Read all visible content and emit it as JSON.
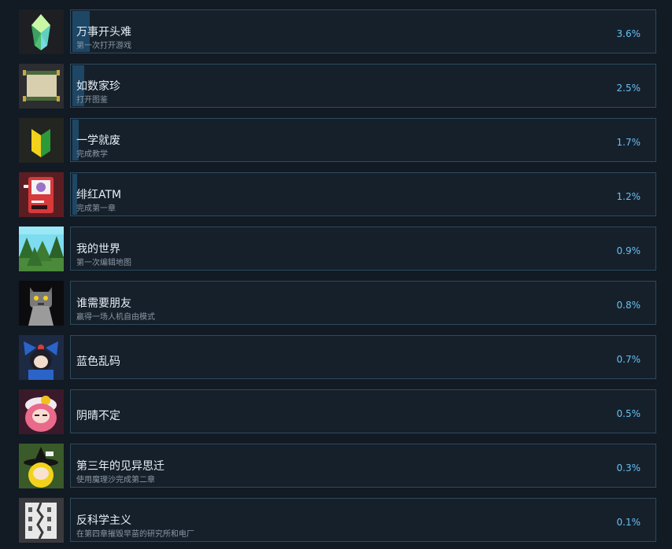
{
  "achievements": [
    {
      "title": "万事开头难",
      "desc": "第一次打开游戏",
      "pct": "3.6%",
      "progress": 3.6,
      "icon": "green-crystal-icon"
    },
    {
      "title": "如数家珍",
      "desc": "打开图鉴",
      "pct": "2.5%",
      "progress": 2.5,
      "icon": "scroll-icon"
    },
    {
      "title": "一学就废",
      "desc": "完成教学",
      "pct": "1.7%",
      "progress": 1.7,
      "icon": "beginner-mark-icon"
    },
    {
      "title": "绯红ATM",
      "desc": "完成第一章",
      "pct": "1.2%",
      "progress": 1.2,
      "icon": "red-atm-icon"
    },
    {
      "title": "我的世界",
      "desc": "第一次编辑地图",
      "pct": "0.9%",
      "progress": 0.9,
      "icon": "forest-landscape-icon"
    },
    {
      "title": "谁需要朋友",
      "desc": "赢得一场人机自由模式",
      "pct": "0.8%",
      "progress": 0.8,
      "icon": "gray-robot-cat-icon"
    },
    {
      "title": "蓝色乱码",
      "desc": "",
      "pct": "0.7%",
      "progress": 0.7,
      "icon": "blue-bow-girl-icon"
    },
    {
      "title": "阴晴不定",
      "desc": "",
      "pct": "0.5%",
      "progress": 0.5,
      "icon": "pink-hair-girl-icon"
    },
    {
      "title": "第三年的见异思迁",
      "desc": "使用魔理沙完成第二章",
      "pct": "0.3%",
      "progress": 0.3,
      "icon": "witch-hat-girl-icon"
    },
    {
      "title": "反科学主义",
      "desc": "在第四章摧毁早苗的研究所和电厂",
      "pct": "0.1%",
      "progress": 0.1,
      "icon": "broken-building-icon"
    }
  ]
}
